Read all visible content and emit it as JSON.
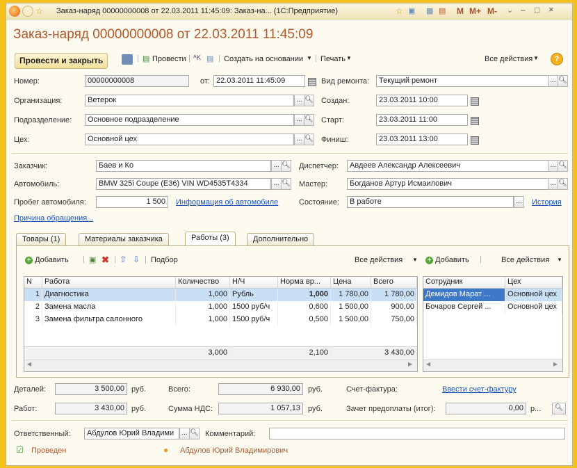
{
  "window": {
    "title": "Заказ-наряд 00000000008 от 22.03.2011 11:45:09: Заказ-на... (1С:Предприятие)",
    "right_controls": [
      "M",
      "M+",
      "M-"
    ]
  },
  "form_title": "Заказ-наряд 00000000008 от 22.03.2011 11:45:09",
  "toolbar": {
    "post_close": "Провести и закрыть",
    "post": "Провести",
    "create_based": "Создать на основании",
    "print": "Печать",
    "all_actions": "Все действия",
    "help": "?"
  },
  "header": {
    "number_label": "Номер:",
    "number": "00000000008",
    "from_label": "от:",
    "date": "22.03.2011 11:45:09",
    "repair_type_label": "Вид ремонта:",
    "repair_type": "Текущий ремонт",
    "org_label": "Организация:",
    "org": "Ветерок",
    "created_label": "Создан:",
    "created": "23.03.2011 10:00",
    "dept_label": "Подразделение:",
    "dept": "Основное подразделение",
    "start_label": "Старт:",
    "start": "23.03.2011 11:00",
    "shop_label": "Цех:",
    "shop": "Основной цех",
    "finish_label": "Финиш:",
    "finish": "23.03.2011 13:00"
  },
  "client": {
    "customer_label": "Заказчик:",
    "customer": "Баев и Ко",
    "dispatcher_label": "Диспетчер:",
    "dispatcher": "Авдеев Александр Алексеевич",
    "car_label": "Автомобиль:",
    "car": "BMW 325i Coupe (E36) VIN WD4535T4334",
    "master_label": "Мастер:",
    "master": "Богданов Артур Исмаилович",
    "mileage_label": "Пробег автомобиля:",
    "mileage": "1 500",
    "car_info_link": "Информация об автомобиле",
    "state_label": "Состояние:",
    "state": "В работе",
    "history_link": "История",
    "reason_link": "Причина обращения..."
  },
  "tabs": [
    {
      "label": "Товары (1)"
    },
    {
      "label": "Материалы заказчика"
    },
    {
      "label": "Работы (3)"
    },
    {
      "label": "Дополнительно"
    }
  ],
  "works": {
    "add": "Добавить",
    "selection": "Подбор",
    "all_actions": "Все действия",
    "columns": [
      "N",
      "Работа",
      "Количество",
      "Н/Ч",
      "Норма вр...",
      "Цена",
      "Всего"
    ],
    "rows": [
      [
        "1",
        "Диагностика",
        "1,000",
        "Рубль",
        "1,000",
        "1 780,00",
        "1 780,00"
      ],
      [
        "2",
        "Замена масла",
        "1,000",
        "1500 руб/ч",
        "0,600",
        "1 500,00",
        "900,00"
      ],
      [
        "3",
        "Замена фильтра салонного",
        "1,000",
        "1500 руб/ч",
        "0,500",
        "1 500,00",
        "750,00"
      ]
    ],
    "totals": {
      "qty": "3,000",
      "norm": "2,100",
      "sum": "3 430,00"
    }
  },
  "staff": {
    "add": "Добавить",
    "all_actions": "Все действия",
    "columns": [
      "Сотрудник",
      "Цех"
    ],
    "rows": [
      [
        "Демидов Марат ...",
        "Основной цех"
      ],
      [
        "Бочаров Сергей ...",
        "Основной цех"
      ]
    ]
  },
  "summary": {
    "parts_label": "Деталей:",
    "parts": "3 500,00",
    "works_label": "Работ:",
    "works": "3 430,00",
    "rub": "руб.",
    "total_label": "Всего:",
    "total": "6 930,00",
    "vat_label": "Сумма НДС:",
    "vat": "1 057,13",
    "invoice_label": "Счет-фактура:",
    "invoice_link": "Ввести счет-фактуру",
    "prepay_label": "Зачет предоплаты (итог):",
    "prepay": "0,00",
    "prepay_unit": "р..."
  },
  "footer": {
    "responsible_label": "Ответственный:",
    "responsible": "Абдулов Юрий Владими",
    "comment_label": "Комментарий:",
    "comment": "",
    "status": "Проведен",
    "author": "Абдулов Юрий Владимирович"
  },
  "colors": {
    "accent": "#f4c11a",
    "title": "#b0592c",
    "link": "#1b57b5",
    "selection": "#c9dff5"
  }
}
